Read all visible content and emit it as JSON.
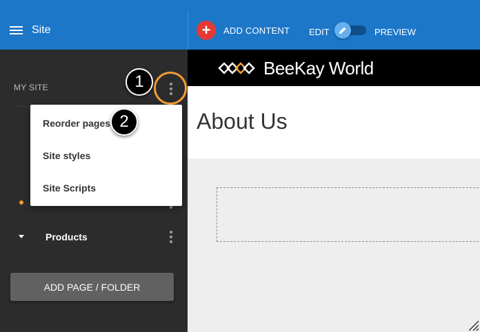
{
  "sidebar": {
    "title": "Site",
    "section_label": "MY SITE",
    "pages": [
      {
        "label": "About Us",
        "active": true
      },
      {
        "label": "Products",
        "expandable": true
      }
    ],
    "add_button_label": "ADD PAGE / FOLDER"
  },
  "menu": {
    "items": [
      {
        "label": "Reorder pages"
      },
      {
        "label": "Site styles"
      },
      {
        "label": "Site Scripts"
      }
    ]
  },
  "toolbar": {
    "add_content_label": "ADD CONTENT",
    "edit_label": "EDIT",
    "preview_label": "PREVIEW"
  },
  "main": {
    "brand_name": "BeeKay World",
    "page_title": "About Us"
  },
  "callouts": {
    "one": "1",
    "two": "2"
  },
  "colors": {
    "brand_blue": "#1c77c9",
    "sidebar_bg": "#2c2c2c",
    "accent_orange": "#f39c34",
    "add_red": "#e53935"
  }
}
